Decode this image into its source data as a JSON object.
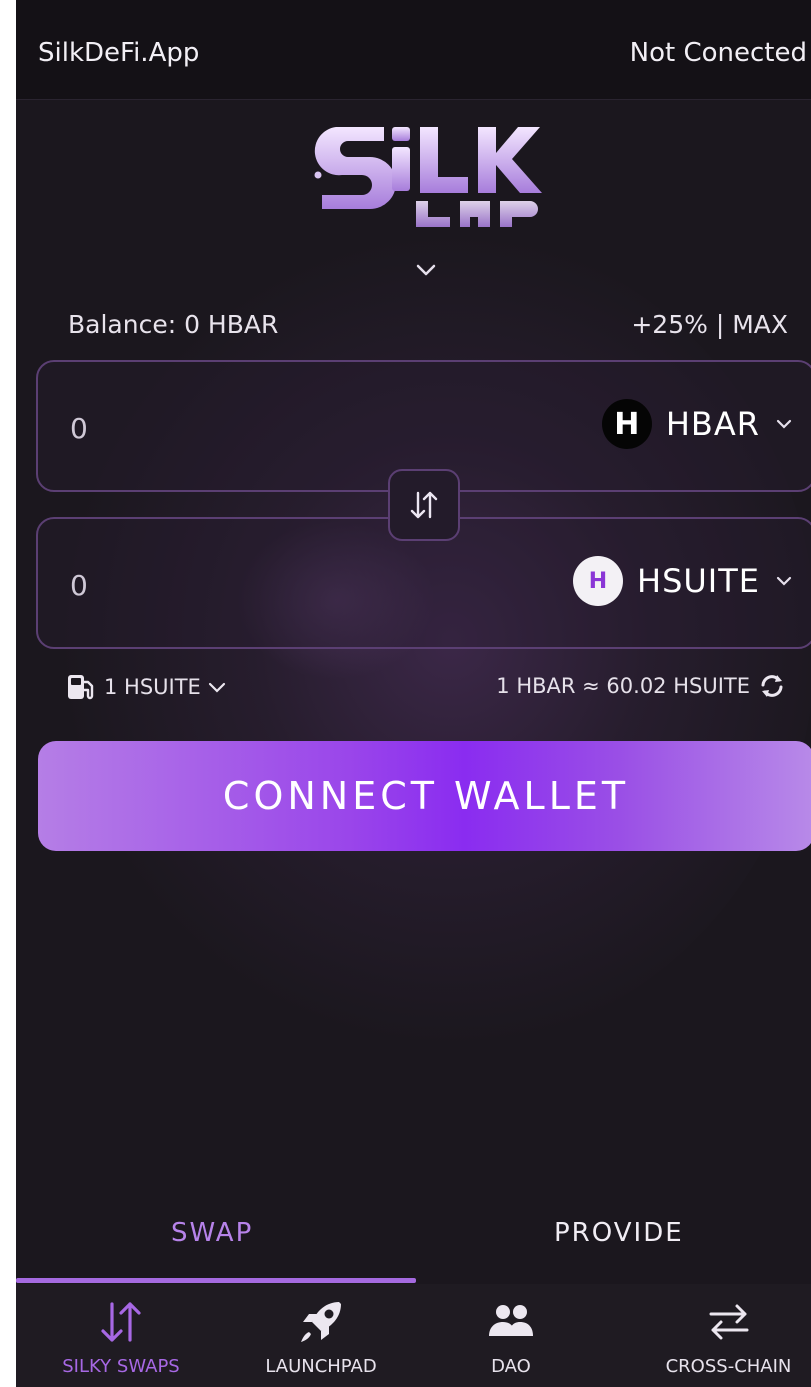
{
  "topbar": {
    "app_name": "SilkDeFi.App",
    "status": "Not Conected"
  },
  "balance": {
    "label": "Balance: 0 HBAR",
    "shortcuts": "+25% | MAX"
  },
  "from_token": {
    "amount": "0",
    "symbol": "HBAR",
    "icon_letter": "H"
  },
  "to_token": {
    "amount": "0",
    "symbol": "HSUITE",
    "icon_letter": "H"
  },
  "gas": {
    "label": "1 HSUITE"
  },
  "rate": {
    "text": "1 HBAR ≈ 60.02 HSUITE"
  },
  "connect_button": "CONNECT WALLET",
  "tabs": {
    "swap": "SWAP",
    "provide": "PROVIDE"
  },
  "nav": [
    {
      "label": "SILKY SWAPS",
      "icon": "swap-arrows-icon"
    },
    {
      "label": "LAUNCHPAD",
      "icon": "rocket-icon"
    },
    {
      "label": "DAO",
      "icon": "users-icon"
    },
    {
      "label": "CROSS-CHAIN",
      "icon": "exchange-arrows-icon"
    }
  ],
  "colors": {
    "accent": "#a56ae0",
    "background": "#1b171e",
    "button_gradient_mid": "#8a2cf0"
  }
}
